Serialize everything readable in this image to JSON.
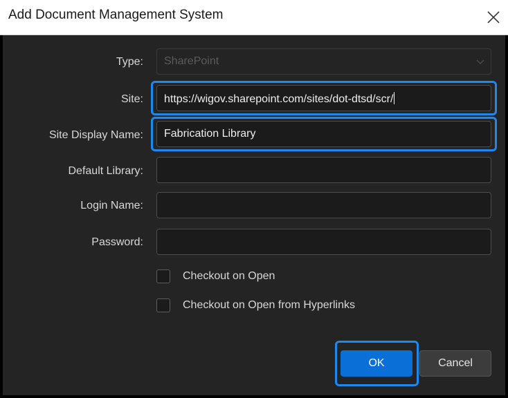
{
  "dialog": {
    "title": "Add Document Management System",
    "close_icon": "close-icon"
  },
  "form": {
    "type": {
      "label": "Type:",
      "value": "SharePoint",
      "disabled": true
    },
    "site": {
      "label": "Site:",
      "value": "https://wigov.sharepoint.com/sites/dot-dtsd/scr/"
    },
    "site_display_name": {
      "label": "Site Display Name:",
      "value": "Fabrication Library"
    },
    "default_library": {
      "label": "Default Library:",
      "value": ""
    },
    "login_name": {
      "label": "Login Name:",
      "value": ""
    },
    "password": {
      "label": "Password:",
      "value": ""
    },
    "checkout_on_open": {
      "label": "Checkout on Open",
      "checked": false
    },
    "checkout_on_open_hyperlinks": {
      "label": "Checkout on Open from Hyperlinks",
      "checked": false
    }
  },
  "buttons": {
    "ok": "OK",
    "cancel": "Cancel"
  },
  "colors": {
    "accent": "#1e88f0",
    "primary_button": "#0a6fd6",
    "panel_background": "#242424"
  }
}
